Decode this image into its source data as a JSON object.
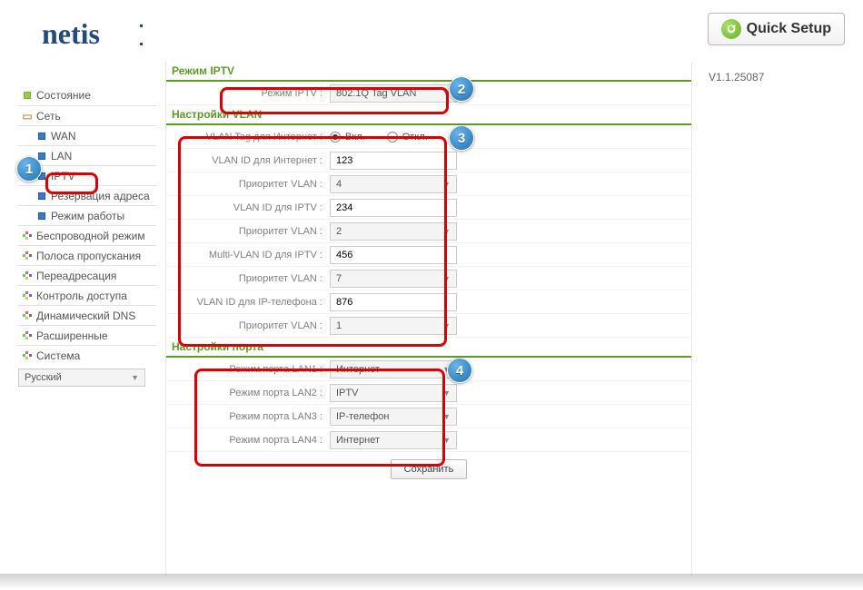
{
  "brand": "netis",
  "quick_setup_label": "Quick Setup",
  "version": "V1.1.25087",
  "language": "Русский",
  "sidebar": {
    "status": "Состояние",
    "network": "Сеть",
    "sub": {
      "wan": "WAN",
      "lan": "LAN",
      "iptv": "IPTV",
      "address_reservation": "Резервация адреса",
      "operation_mode": "Режим работы"
    },
    "wireless": "Беспроводной режим",
    "bandwidth": "Полоса пропускания",
    "forwarding": "Переадресация",
    "access_control": "Контроль доступа",
    "ddns": "Динамический DNS",
    "advanced": "Расширенные",
    "system": "Система"
  },
  "iptv_section_title": "Режим IPTV",
  "iptv_mode_label": "Режим IPTV :",
  "iptv_mode_value": "802.1Q Tag VLAN",
  "vlan_section_title": "Настройки VLAN",
  "vlan": {
    "tag_label": "VLAN Tag для Интернет :",
    "tag_on": "Вкл.",
    "tag_off": "Откл.",
    "id_inet_label": "VLAN ID для Интернет :",
    "id_inet_value": "123",
    "pri_label": "Приоритет VLAN :",
    "pri_inet": "4",
    "id_iptv_label": "VLAN ID для IPTV :",
    "id_iptv_value": "234",
    "pri_iptv": "2",
    "multi_id_label": "Multi-VLAN ID для IPTV :",
    "multi_id_value": "456",
    "pri_multi": "7",
    "id_phone_label": "VLAN ID для IP-телефона :",
    "id_phone_value": "876",
    "pri_phone": "1"
  },
  "ports_section_title": "Настройки порта",
  "ports": {
    "lan1_label": "Режим порта LAN1 :",
    "lan1_value": "Интернет",
    "lan2_label": "Режим порта LAN2 :",
    "lan2_value": "IPTV",
    "lan3_label": "Режим порта LAN3 :",
    "lan3_value": "IP-телефон",
    "lan4_label": "Режим порта LAN4 :",
    "lan4_value": "Интернет"
  },
  "save_label": "Сохранить",
  "callouts": {
    "c1": "1",
    "c2": "2",
    "c3": "3",
    "c4": "4"
  }
}
